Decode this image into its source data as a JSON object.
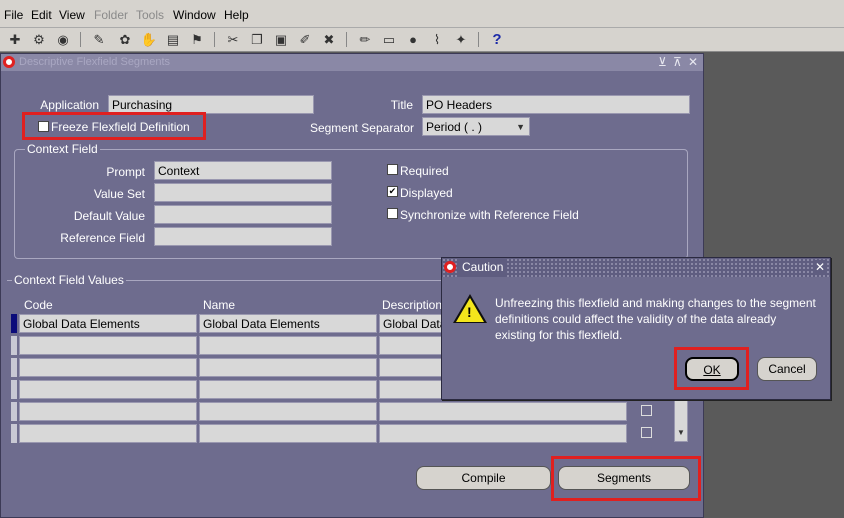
{
  "menu": [
    "File",
    "Edit",
    "View",
    "Folder",
    "Tools",
    "Window",
    "Help"
  ],
  "window": {
    "title": "Descriptive Flexfield Segments"
  },
  "header": {
    "application_label": "Application",
    "application_value": "Purchasing",
    "title_label": "Title",
    "title_value": "PO Headers",
    "freeze_label": "Freeze Flexfield Definition",
    "separator_label": "Segment Separator",
    "separator_value": "Period ( . )"
  },
  "context_field": {
    "group_label": "Context Field",
    "prompt_label": "Prompt",
    "prompt_value": "Context",
    "value_set_label": "Value Set",
    "default_value_label": "Default Value",
    "reference_field_label": "Reference Field",
    "required_label": "Required",
    "displayed_label": "Displayed",
    "synchronize_label": "Synchronize with Reference Field"
  },
  "context_values": {
    "group_label": "Context Field Values",
    "columns": [
      "Code",
      "Name",
      "Description"
    ],
    "rows": [
      [
        "Global Data Elements",
        "Global Data Elements",
        "Global Data"
      ],
      [
        "",
        "",
        ""
      ],
      [
        "",
        "",
        ""
      ],
      [
        "",
        "",
        ""
      ],
      [
        "",
        "",
        ""
      ],
      [
        "",
        "",
        ""
      ]
    ]
  },
  "buttons": {
    "compile": "Compile",
    "segments": "Segments"
  },
  "dialog": {
    "title": "Caution",
    "message_1": "Unfreezing this flexfield and making changes to the segment",
    "message_2": "definitions could affect the validity of the data already",
    "message_3": "existing for this flexfield.",
    "ok": "OK",
    "cancel": "Cancel"
  },
  "state": {
    "freeze_checked": false,
    "required_checked": false,
    "displayed_checked": true,
    "synchronize_checked": false
  },
  "colors": {
    "highlight": "#e02020",
    "window_bg": "#6e6c8e"
  }
}
